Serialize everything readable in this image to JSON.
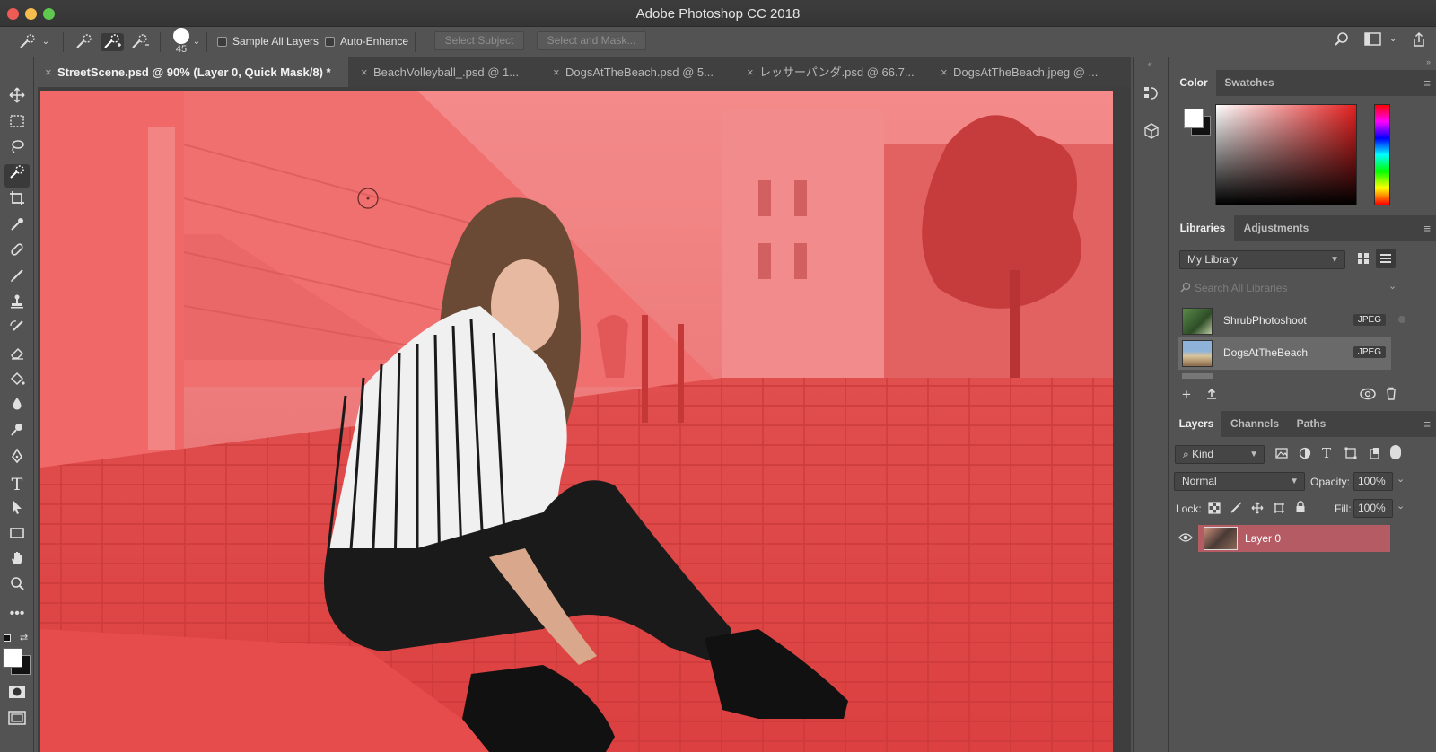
{
  "window": {
    "title": "Adobe Photoshop CC 2018"
  },
  "options_bar": {
    "brush_size": "45",
    "sample_all_layers_label": "Sample All Layers",
    "auto_enhance_label": "Auto-Enhance",
    "select_subject_label": "Select Subject",
    "select_and_mask_label": "Select and Mask..."
  },
  "doc_tabs": [
    {
      "label": "StreetScene.psd @ 90% (Layer 0, Quick Mask/8) *",
      "active": true
    },
    {
      "label": "BeachVolleyball_.psd @ 1..."
    },
    {
      "label": "DogsAtTheBeach.psd @ 5..."
    },
    {
      "label": "レッサーパンダ.psd @ 66.7..."
    },
    {
      "label": "DogsAtTheBeach.jpeg @ ..."
    }
  ],
  "color_panel": {
    "tabs": [
      "Color",
      "Swatches"
    ],
    "foreground": "#ffffff",
    "background": "#111111"
  },
  "libraries_panel": {
    "tabs": [
      "Libraries",
      "Adjustments"
    ],
    "library_name": "My Library",
    "search_placeholder": "Search All Libraries",
    "items": [
      {
        "name": "ShrubPhotoshoot",
        "badge": "JPEG"
      },
      {
        "name": "DogsAtTheBeach",
        "badge": "JPEG"
      }
    ]
  },
  "layers_panel": {
    "tabs": [
      "Layers",
      "Channels",
      "Paths"
    ],
    "filter_label": "Kind",
    "blend_mode": "Normal",
    "opacity_label": "Opacity:",
    "opacity_value": "100%",
    "lock_label": "Lock:",
    "fill_label": "Fill:",
    "fill_value": "100%",
    "layers": [
      {
        "name": "Layer 0",
        "visible": true
      }
    ]
  },
  "colors": {
    "quick_mask_overlay": "#e25858",
    "selected_layer": "#b55b63"
  }
}
